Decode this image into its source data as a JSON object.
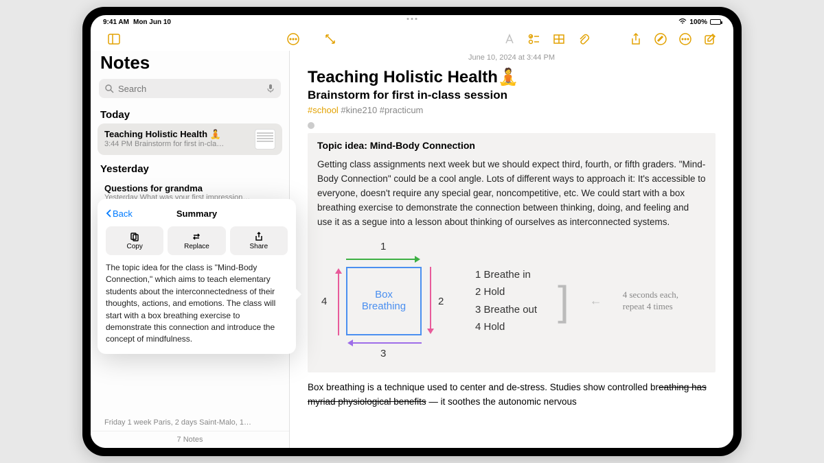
{
  "status": {
    "time": "9:41 AM",
    "date": "Mon Jun 10",
    "battery": "100%"
  },
  "sidebar": {
    "title": "Notes",
    "search_placeholder": "Search",
    "sections": {
      "today": "Today",
      "yesterday": "Yesterday"
    },
    "items": [
      {
        "title": "Teaching Holistic Health 🧘",
        "sub": "3:44 PM  Brainstorm for first in-cla…"
      },
      {
        "title": "Questions for grandma",
        "sub": "Yesterday  What was your first impression…"
      }
    ],
    "trip_row": "Friday  1 week Paris, 2 days Saint-Malo, 1…",
    "footer": "7 Notes"
  },
  "popover": {
    "back": "Back",
    "title": "Summary",
    "buttons": {
      "copy": "Copy",
      "replace": "Replace",
      "share": "Share"
    },
    "body": "The topic idea for the class is \"Mind-Body Connection,\" which aims to teach elementary students about the interconnectedness of their thoughts, actions, and emotions. The class will start with a box breathing exercise to demonstrate this connection and introduce the concept of mindfulness."
  },
  "note": {
    "date": "June 10, 2024 at 3:44 PM",
    "title": "Teaching Holistic Health🧘",
    "subtitle": "Brainstorm for first in-class session",
    "tag_school": "#school",
    "tag_rest": " #kine210 #practicum",
    "topic_title": "Topic idea: Mind-Body Connection",
    "body1": "Getting class assignments next week but we should expect third, fourth, or fifth graders. \"Mind-Body Connection\" could be a cool angle. Lots of different ways to approach it: It's accessible to everyone, doesn't require any special gear, noncompetitive, etc. We could start with a box breathing exercise to demonstrate the connection between thinking, doing, and feeling and use it as a segue into a lesson about thinking of ourselves as interconnected systems.",
    "box_label": "Box\nBreathing",
    "nums": {
      "n1": "1",
      "n2": "2",
      "n3": "3",
      "n4": "4"
    },
    "steps": [
      "1  Breathe in",
      "2  Hold",
      "3  Breathe out",
      "4  Hold"
    ],
    "steps_note": "4 seconds each,\nrepeat 4 times",
    "closing_a": "Box breathing is a technique used to center and de-stress. Studies show controlled br",
    "closing_strike": "eathing has myriad physiological benefits",
    "closing_b": " — it soothes the autonomic nervous"
  }
}
